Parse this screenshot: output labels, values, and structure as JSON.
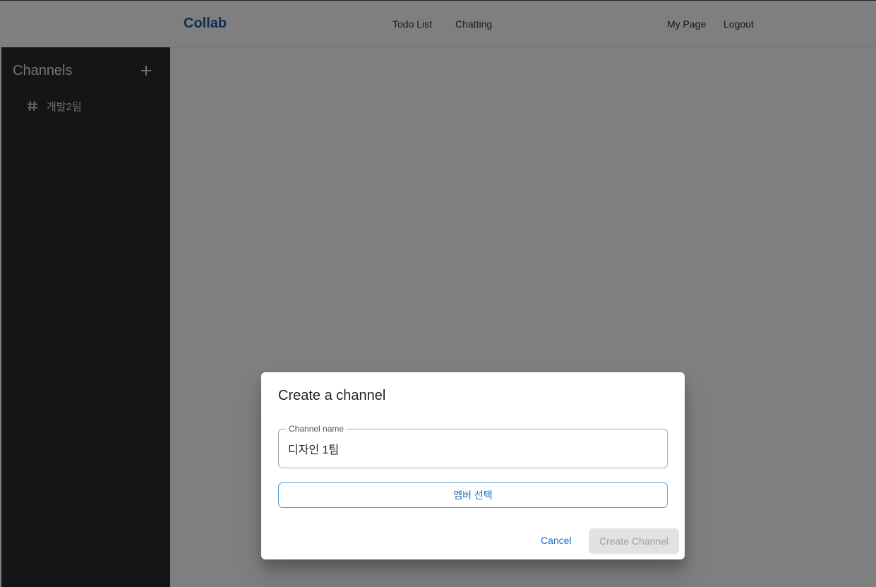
{
  "header": {
    "brand": "Collab",
    "nav": {
      "todo": "Todo List",
      "chatting": "Chatting",
      "my_page": "My Page",
      "logout": "Logout"
    }
  },
  "sidebar": {
    "title": "Channels",
    "add_icon": "plus-icon",
    "channels": [
      {
        "icon": "hash-icon",
        "label": "개발2팀"
      }
    ]
  },
  "dialog": {
    "title": "Create a channel",
    "channel_name_label": "Channel name",
    "channel_name_value": "디자인 1팀",
    "member_select_label": "멤버 선택",
    "cancel_label": "Cancel",
    "create_label": "Create Channel"
  },
  "colors": {
    "brand": "#1f5fa8",
    "sidebar_bg": "#2b2b2f",
    "accent": "#1f6fc0",
    "disabled_bg": "#e2e2e2"
  }
}
